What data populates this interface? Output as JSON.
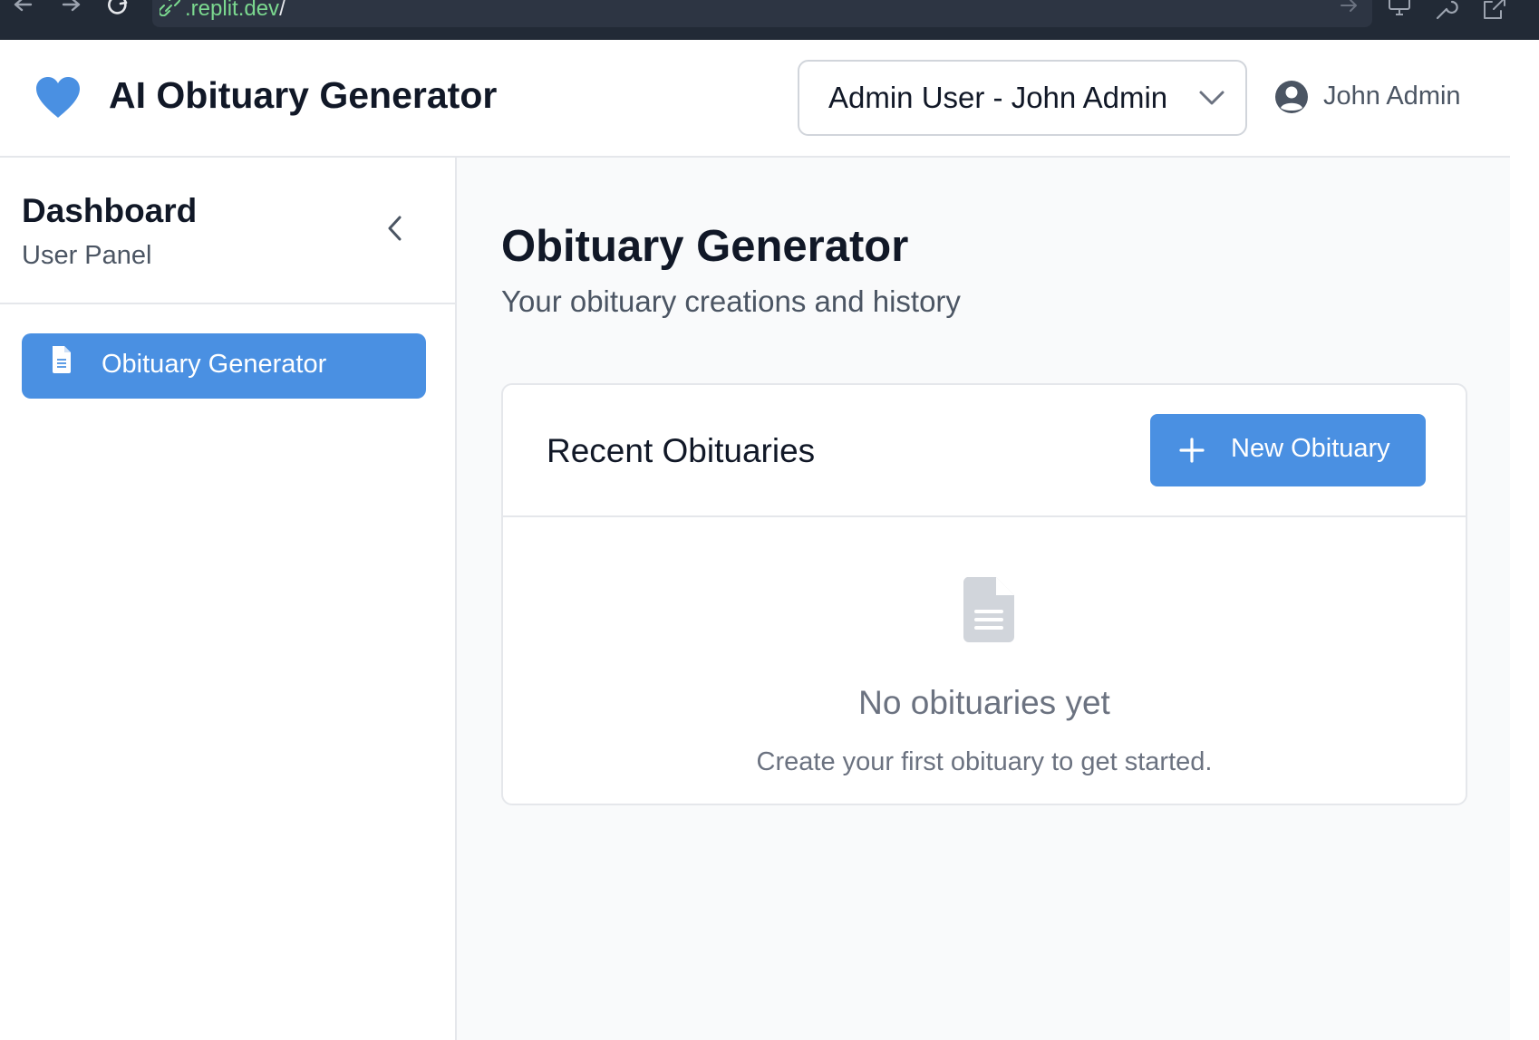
{
  "browser": {
    "url_domain": ".replit.dev",
    "url_path": "/",
    "icons": [
      "back-arrow-icon",
      "forward-arrow-icon",
      "reload-icon",
      "link-icon",
      "go-arrow-icon",
      "monitor-icon",
      "wrench-icon",
      "external-link-icon"
    ]
  },
  "header": {
    "app_title": "AI Obituary Generator",
    "role_selector_value": "Admin User - John Admin",
    "user_name": "John Admin",
    "icons": [
      "heart-icon",
      "chevron-down-icon",
      "user-avatar-icon"
    ]
  },
  "sidebar": {
    "title": "Dashboard",
    "subtitle": "User Panel",
    "items": [
      {
        "label": "Obituary Generator",
        "icon": "document-icon",
        "active": true
      }
    ]
  },
  "main": {
    "page_title": "Obituary Generator",
    "page_subtitle": "Your obituary creations and history",
    "card": {
      "title": "Recent Obituaries",
      "new_button_label": "New Obituary",
      "empty_title": "No obituaries yet",
      "empty_subtitle": "Create your first obituary to get started."
    }
  },
  "colors": {
    "accent": "#4a90e2",
    "browser_bar": "#222a36",
    "url_text": "#7bd88f",
    "main_bg": "#f9fafb",
    "border": "#e5e7eb"
  }
}
